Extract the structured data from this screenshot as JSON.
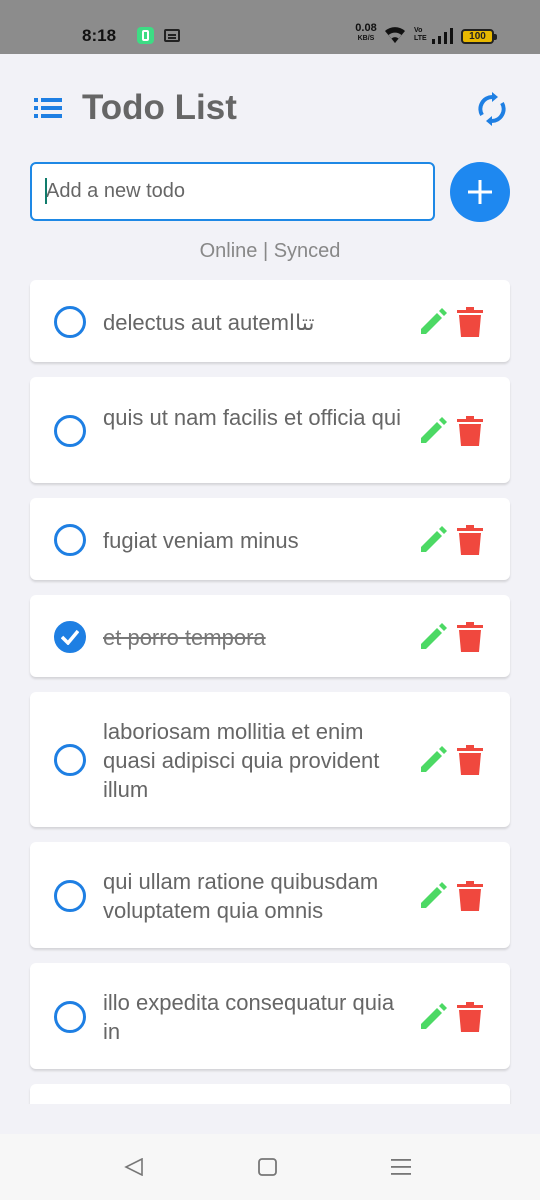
{
  "status_bar": {
    "time": "8:18",
    "net_speed_value": "0.08",
    "net_speed_unit": "KB/S",
    "volte_label": "Vo\nLTE",
    "battery": "100"
  },
  "header": {
    "title": "Todo List",
    "menu_icon": "list-icon",
    "sync_icon": "sync-icon"
  },
  "input": {
    "placeholder": "Add a new todo",
    "value": ""
  },
  "connection_status": "Online | Synced",
  "todos": [
    {
      "text": "delectus aut autemتتاا",
      "done": false
    },
    {
      "text": "quis ut nam facilis et officia qui",
      "done": false
    },
    {
      "text": "fugiat veniam minus",
      "done": false
    },
    {
      "text": "et porro tempora",
      "done": true
    },
    {
      "text": "laboriosam mollitia et enim quasi adipisci quia provident illum",
      "done": false
    },
    {
      "text": "qui ullam ratione quibusdam voluptatem quia omnis",
      "done": false
    },
    {
      "text": "illo expedita consequatur quia in",
      "done": false
    }
  ],
  "colors": {
    "accent": "#1e88f0",
    "edit": "#4cd964",
    "delete": "#f0483e",
    "title": "#666666"
  },
  "nav": [
    "back-icon",
    "home-icon",
    "recents-icon"
  ]
}
